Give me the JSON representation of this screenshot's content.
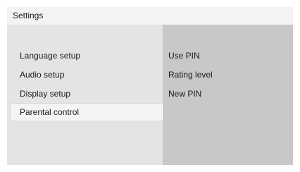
{
  "window": {
    "title": "Settings"
  },
  "menu": {
    "items": [
      {
        "label": "Language setup"
      },
      {
        "label": "Audio setup"
      },
      {
        "label": "Display setup"
      },
      {
        "label": "Parental control",
        "selected": true
      }
    ]
  },
  "submenu": {
    "items": [
      {
        "label": "Use PIN"
      },
      {
        "label": "Rating level"
      },
      {
        "label": "New PIN"
      }
    ]
  },
  "colors": {
    "title_bar_bg": "#f3f3f3",
    "left_panel_bg": "#e4e4e4",
    "right_panel_bg": "#c8c8c8",
    "selected_item_bg": "#f4f4f4"
  }
}
